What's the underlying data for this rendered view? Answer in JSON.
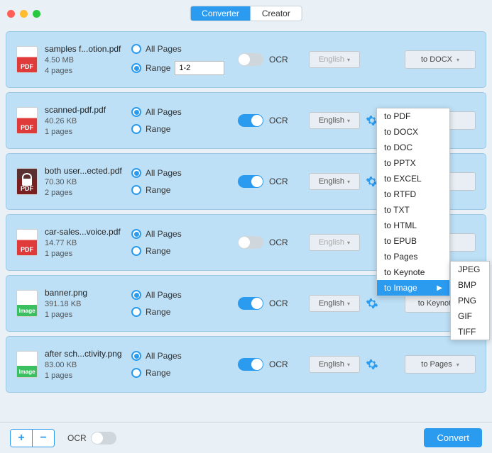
{
  "header": {
    "tabs": {
      "converter": "Converter",
      "creator": "Creator"
    }
  },
  "files": [
    {
      "icon": "pdf",
      "name": "samples f...otion.pdf",
      "size": "4.50 MB",
      "pages": "4 pages",
      "all_pages": "All Pages",
      "range": "Range",
      "range_sel": "range",
      "range_val": "1-2",
      "ocr": false,
      "ocr_label": "OCR",
      "lang": "English",
      "gear": false,
      "target": "to DOCX"
    },
    {
      "icon": "pdf",
      "name": "scanned-pdf.pdf",
      "size": "40.26 KB",
      "pages": "1 pages",
      "all_pages": "All Pages",
      "range": "Range",
      "range_sel": "all",
      "ocr": true,
      "ocr_label": "OCR",
      "lang": "English",
      "gear": true,
      "target": ""
    },
    {
      "icon": "pdflock",
      "name": "both user...ected.pdf",
      "size": "70.30 KB",
      "pages": "2 pages",
      "all_pages": "All Pages",
      "range": "Range",
      "range_sel": "all",
      "ocr": true,
      "ocr_label": "OCR",
      "lang": "English",
      "gear": true,
      "target": ""
    },
    {
      "icon": "pdf",
      "name": "car-sales...voice.pdf",
      "size": "14.77 KB",
      "pages": "1 pages",
      "all_pages": "All Pages",
      "range": "Range",
      "range_sel": "all",
      "ocr": false,
      "ocr_label": "OCR",
      "lang": "English",
      "gear": false,
      "target": ""
    },
    {
      "icon": "image",
      "name": "banner.png",
      "size": "391.18 KB",
      "pages": "1 pages",
      "all_pages": "All Pages",
      "range": "Range",
      "range_sel": "all",
      "ocr": true,
      "ocr_label": "OCR",
      "lang": "English",
      "gear": true,
      "target": "to Keynote"
    },
    {
      "icon": "image",
      "name": "after sch...ctivity.png",
      "size": "83.00 KB",
      "pages": "1 pages",
      "all_pages": "All Pages",
      "range": "Range",
      "range_sel": "all",
      "ocr": true,
      "ocr_label": "OCR",
      "lang": "English",
      "gear": true,
      "target": "to Pages"
    }
  ],
  "dropdown": {
    "items": [
      "to PDF",
      "to DOCX",
      "to DOC",
      "to PPTX",
      "to EXCEL",
      "to RTFD",
      "to TXT",
      "to HTML",
      "to EPUB",
      "to Pages",
      "to Keynote",
      "to Image"
    ],
    "highlighted": "to Image"
  },
  "submenu": {
    "items": [
      "JPEG",
      "BMP",
      "PNG",
      "GIF",
      "TIFF"
    ]
  },
  "footer": {
    "add": "+",
    "remove": "−",
    "ocr": "OCR",
    "convert": "Convert"
  }
}
